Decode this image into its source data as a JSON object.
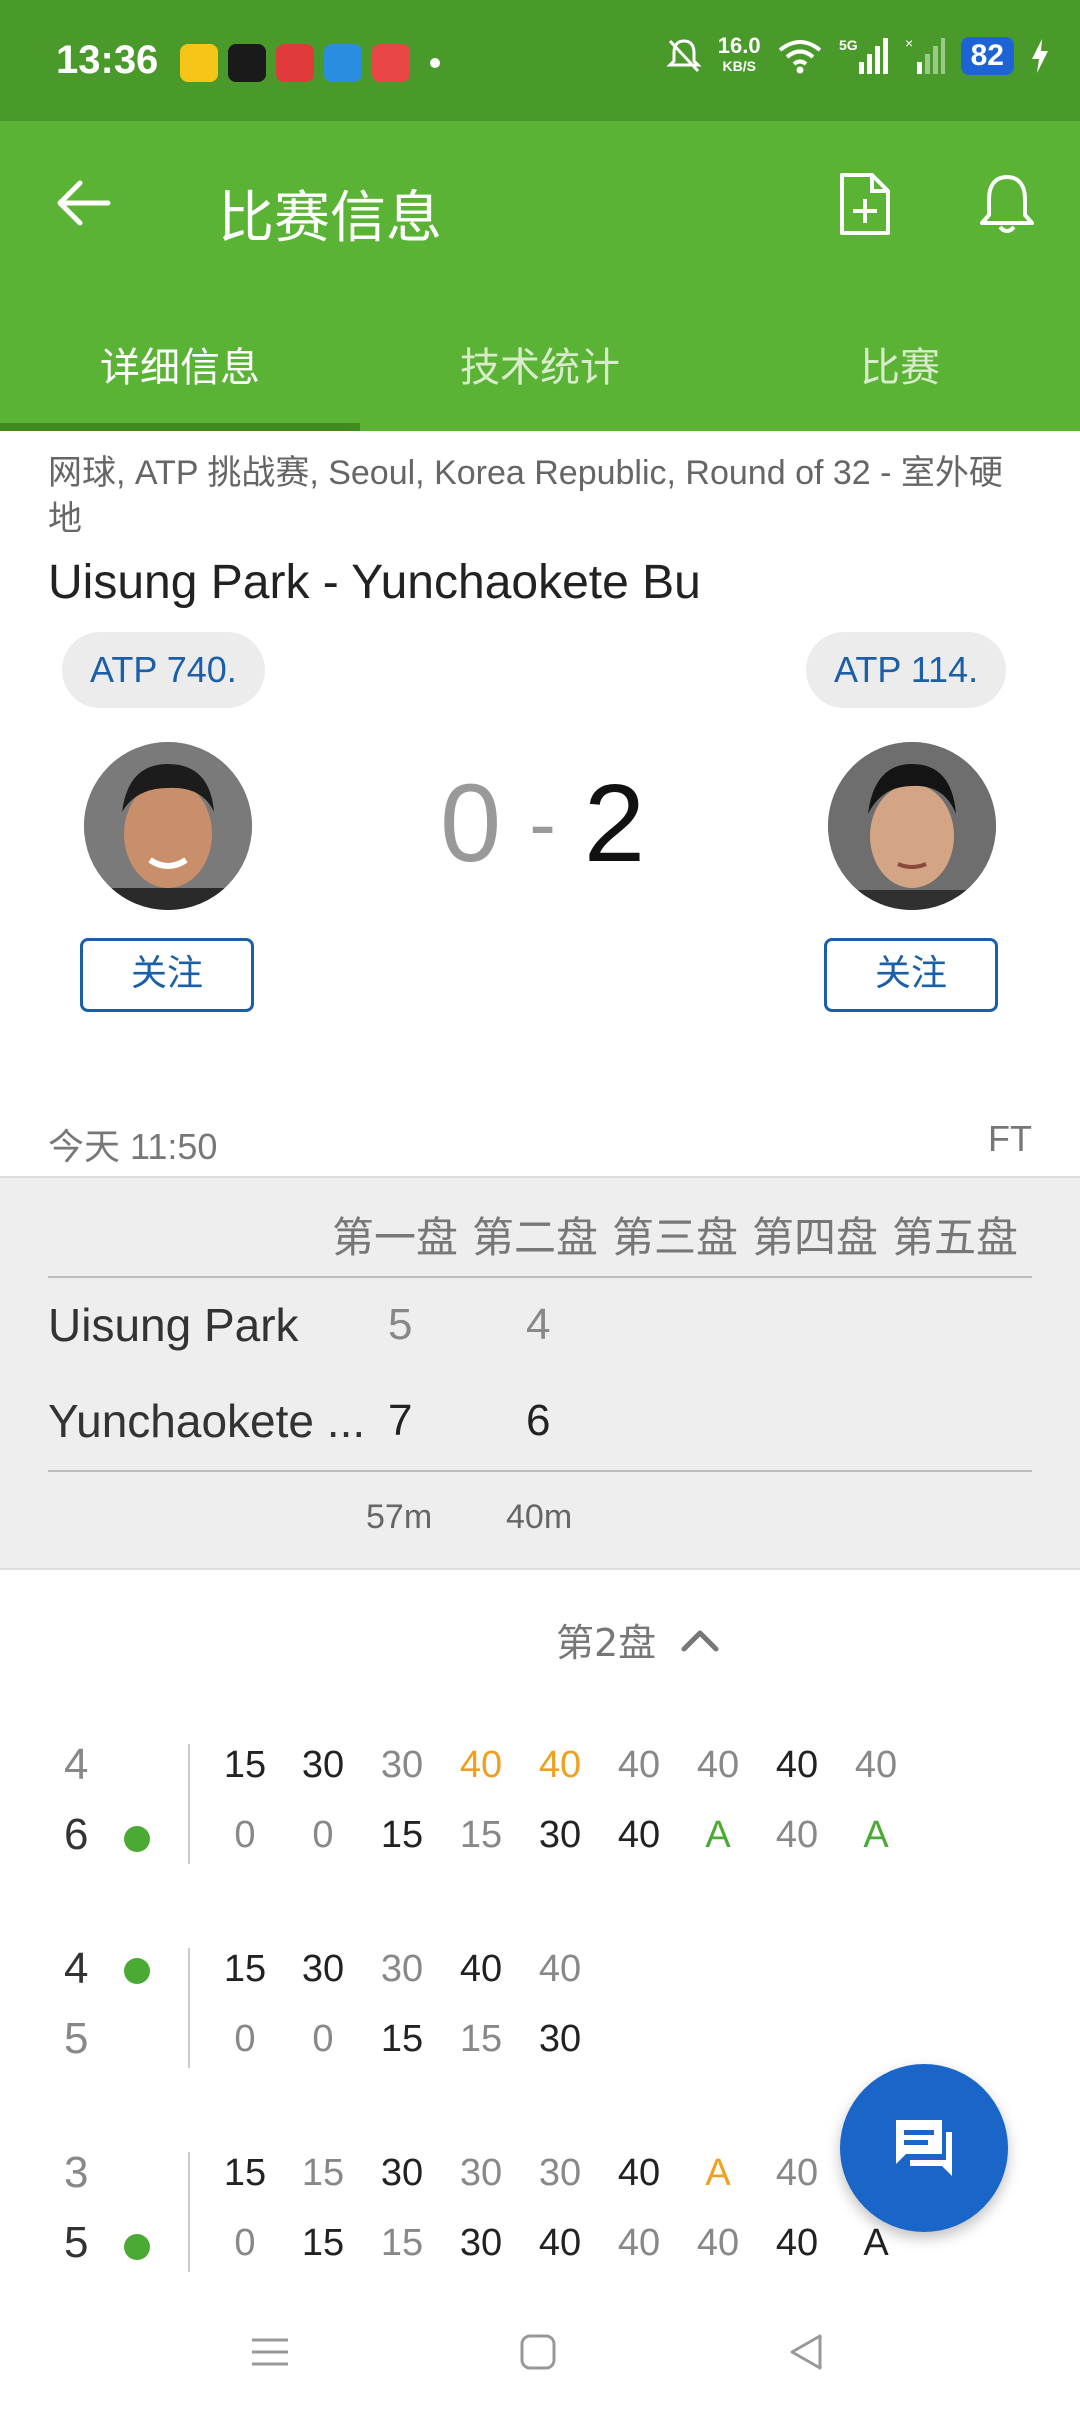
{
  "status_bar": {
    "time": "13:36",
    "network_speed": "16.0",
    "network_unit": "KB/S",
    "battery": "82"
  },
  "app_bar": {
    "title": "比赛信息"
  },
  "tabs": [
    {
      "label": "详细信息",
      "active": true
    },
    {
      "label": "技术统计",
      "active": false
    },
    {
      "label": "比赛",
      "active": false
    }
  ],
  "match": {
    "meta": "网球, ATP 挑战赛, Seoul, Korea Republic, Round of 32 - 室外硬地",
    "players_title": "Uisung Park - Yunchaokete Bu",
    "left_rank": "ATP 740.",
    "right_rank": "ATP 114.",
    "score_left": "0",
    "score_sep": "-",
    "score_right": "2",
    "follow_left": "关注",
    "follow_right": "关注",
    "time": "今天 11:50",
    "status": "FT"
  },
  "sets": {
    "headers": [
      "第一盘",
      "第二盘",
      "第三盘",
      "第四盘",
      "第五盘"
    ],
    "players": [
      {
        "name": "Uisung Park",
        "scores": [
          "5",
          "4"
        ]
      },
      {
        "name": "Yunchaokete ...",
        "scores": [
          "7",
          "6"
        ]
      }
    ],
    "durations": [
      "57m",
      "40m"
    ]
  },
  "set_selector": {
    "label": "第2盘"
  },
  "games": [
    {
      "top_score": "4",
      "bottom_score": "6",
      "server": "bottom",
      "top_points": [
        "15",
        "30",
        "30",
        "40",
        "40",
        "40",
        "40",
        "40",
        "40"
      ],
      "bottom_points": [
        "0",
        "0",
        "15",
        "15",
        "30",
        "40",
        "A",
        "40",
        "A"
      ]
    },
    {
      "top_score": "4",
      "bottom_score": "5",
      "server": "top",
      "top_points": [
        "15",
        "30",
        "30",
        "40",
        "40"
      ],
      "bottom_points": [
        "0",
        "0",
        "15",
        "15",
        "30"
      ]
    },
    {
      "top_score": "3",
      "bottom_score": "5",
      "server": "bottom",
      "top_points": [
        "15",
        "15",
        "30",
        "30",
        "30",
        "40",
        "A",
        "40"
      ],
      "bottom_points": [
        "0",
        "15",
        "15",
        "30",
        "40",
        "40",
        "40",
        "40",
        "A"
      ]
    }
  ],
  "colors": {
    "status_bar": "#4a9a2b",
    "app_bar": "#5bb336",
    "accent_blue": "#1a5fa8",
    "serve_green": "#4aaa34",
    "orange": "#f0a020",
    "fab_blue": "#1a66c8"
  }
}
